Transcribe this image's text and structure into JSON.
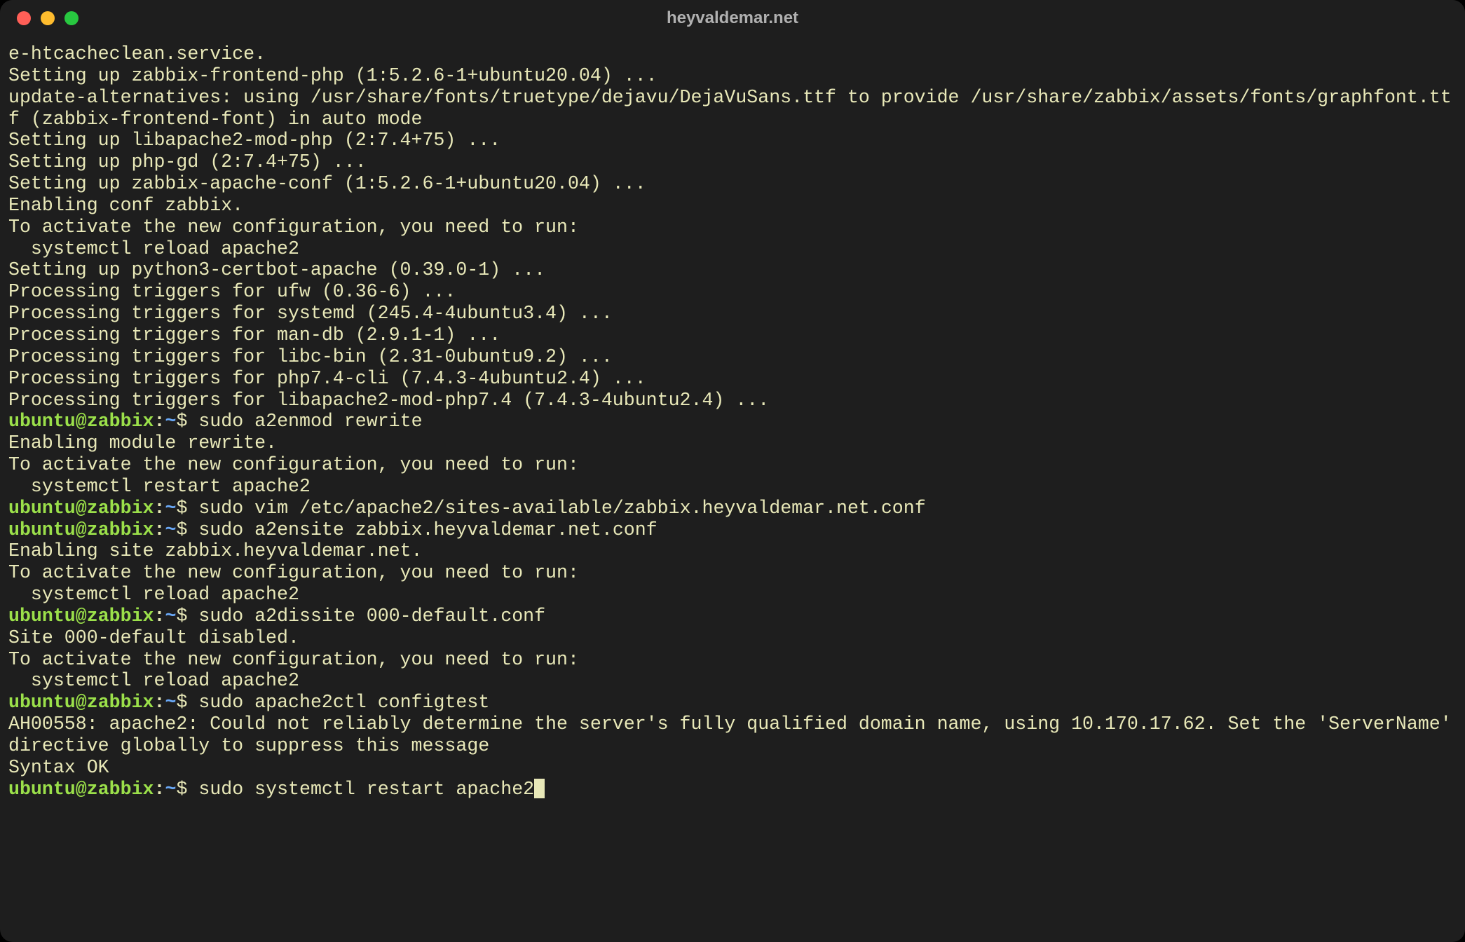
{
  "window": {
    "title": "heyvaldemar.net"
  },
  "colors": {
    "bg": "#1e1e1e",
    "text": "#e8e8b8",
    "promptUserHost": "#9be04a",
    "promptPath": "#6aa9f7",
    "trafficRed": "#ff5f57",
    "trafficYellow": "#febc2e",
    "trafficGreen": "#28c840"
  },
  "prompt": {
    "user": "ubuntu",
    "at": "@",
    "host": "zabbix",
    "colon": ":",
    "path": "~",
    "symbol": "$"
  },
  "lines": [
    {
      "t": "out",
      "text": "e-htcacheclean.service."
    },
    {
      "t": "out",
      "text": "Setting up zabbix-frontend-php (1:5.2.6-1+ubuntu20.04) ..."
    },
    {
      "t": "out",
      "text": "update-alternatives: using /usr/share/fonts/truetype/dejavu/DejaVuSans.ttf to provide /usr/share/zabbix/assets/fonts/graphfont.ttf (zabbix-frontend-font) in auto mode"
    },
    {
      "t": "out",
      "text": "Setting up libapache2-mod-php (2:7.4+75) ..."
    },
    {
      "t": "out",
      "text": "Setting up php-gd (2:7.4+75) ..."
    },
    {
      "t": "out",
      "text": "Setting up zabbix-apache-conf (1:5.2.6-1+ubuntu20.04) ..."
    },
    {
      "t": "out",
      "text": "Enabling conf zabbix."
    },
    {
      "t": "out",
      "text": "To activate the new configuration, you need to run:"
    },
    {
      "t": "out",
      "text": "  systemctl reload apache2"
    },
    {
      "t": "out",
      "text": "Setting up python3-certbot-apache (0.39.0-1) ..."
    },
    {
      "t": "out",
      "text": "Processing triggers for ufw (0.36-6) ..."
    },
    {
      "t": "out",
      "text": "Processing triggers for systemd (245.4-4ubuntu3.4) ..."
    },
    {
      "t": "out",
      "text": "Processing triggers for man-db (2.9.1-1) ..."
    },
    {
      "t": "out",
      "text": "Processing triggers for libc-bin (2.31-0ubuntu9.2) ..."
    },
    {
      "t": "out",
      "text": "Processing triggers for php7.4-cli (7.4.3-4ubuntu2.4) ..."
    },
    {
      "t": "out",
      "text": "Processing triggers for libapache2-mod-php7.4 (7.4.3-4ubuntu2.4) ..."
    },
    {
      "t": "prompt",
      "cmd": "sudo a2enmod rewrite"
    },
    {
      "t": "out",
      "text": "Enabling module rewrite."
    },
    {
      "t": "out",
      "text": "To activate the new configuration, you need to run:"
    },
    {
      "t": "out",
      "text": "  systemctl restart apache2"
    },
    {
      "t": "prompt",
      "cmd": "sudo vim /etc/apache2/sites-available/zabbix.heyvaldemar.net.conf"
    },
    {
      "t": "prompt",
      "cmd": "sudo a2ensite zabbix.heyvaldemar.net.conf"
    },
    {
      "t": "out",
      "text": "Enabling site zabbix.heyvaldemar.net."
    },
    {
      "t": "out",
      "text": "To activate the new configuration, you need to run:"
    },
    {
      "t": "out",
      "text": "  systemctl reload apache2"
    },
    {
      "t": "prompt",
      "cmd": "sudo a2dissite 000-default.conf"
    },
    {
      "t": "out",
      "text": "Site 000-default disabled."
    },
    {
      "t": "out",
      "text": "To activate the new configuration, you need to run:"
    },
    {
      "t": "out",
      "text": "  systemctl reload apache2"
    },
    {
      "t": "prompt",
      "cmd": "sudo apache2ctl configtest"
    },
    {
      "t": "out",
      "text": "AH00558: apache2: Could not reliably determine the server's fully qualified domain name, using 10.170.17.62. Set the 'ServerName' directive globally to suppress this message"
    },
    {
      "t": "out",
      "text": "Syntax OK"
    },
    {
      "t": "prompt",
      "cmd": "sudo systemctl restart apache2",
      "cursor": true
    }
  ]
}
